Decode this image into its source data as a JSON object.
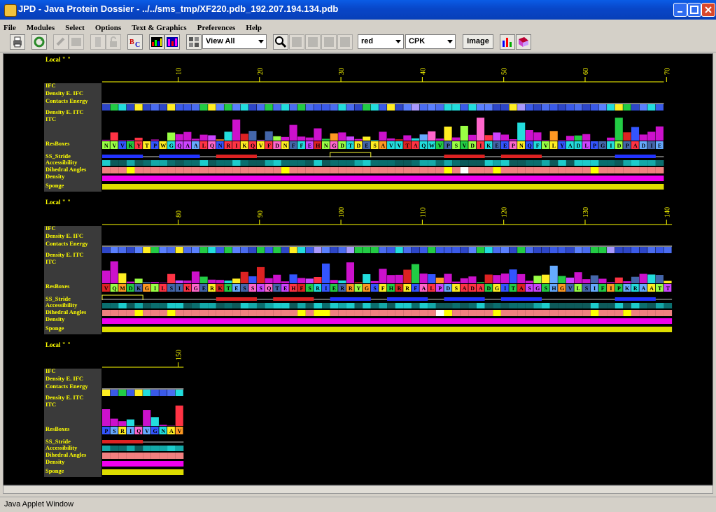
{
  "window": {
    "title": "JPD - Java Protein Dossier - ../../sms_tmp/XF220.pdb_192.207.194.134.pdb"
  },
  "menu": [
    "File",
    "Modules",
    "Select",
    "Options",
    "Text & Graphics",
    "Preferences",
    "Help"
  ],
  "toolbar": {
    "view_select": "View All",
    "color_select": "red",
    "style_select": "CPK",
    "image_button": "Image",
    "icons": [
      "print-icon",
      "refresh-icon",
      "link-icon",
      "grid-icon",
      "document-icon",
      "lock-icon",
      "bc-icon",
      "color-bars-icon",
      "color-bars-2-icon",
      "layout-icon",
      "zoom-icon",
      "panel-1-icon",
      "panel-2-icon",
      "panel-3-icon",
      "panel-4-icon",
      "chart-icon",
      "book-icon"
    ]
  },
  "panels": [
    {
      "local_label": "Local \"  \"",
      "ticks": [
        "10",
        "20",
        "30",
        "40",
        "50",
        "60",
        "70"
      ],
      "sequence": "NVVKYTPWGQAALQNRIKQVFDNFFEHNGDTDESAVVTAQWVPSVDIKEEPNQFVLYADLPGIDPADIE"
    },
    {
      "local_label": "Local \"  \"",
      "ticks": [
        "80",
        "90",
        "100",
        "110",
        "120",
        "130",
        "140"
      ],
      "sequence": "VQMDKGILSIKGERKTESSSQTEHFSRIERRYGSFHRRFALPDSADADGITASGSHGVLSIFIPKRAATT"
    },
    {
      "local_label": "Local \"  \"",
      "ticks": [
        "150"
      ],
      "sequence": "PSRIQVGNAV"
    }
  ],
  "track_labels": [
    "IFC",
    "Density E. IFC",
    "Contacts Energy",
    "Density E. ITC",
    "ITC",
    "ResBoxes",
    "SS_Stride",
    "Accessibility",
    "Dihedral Angles",
    "Density",
    "Sponge"
  ],
  "status": "Java Applet Window",
  "colors": {
    "label": "#ffff00",
    "track_bg": "#3a3a3a",
    "canvas": "#000000"
  }
}
